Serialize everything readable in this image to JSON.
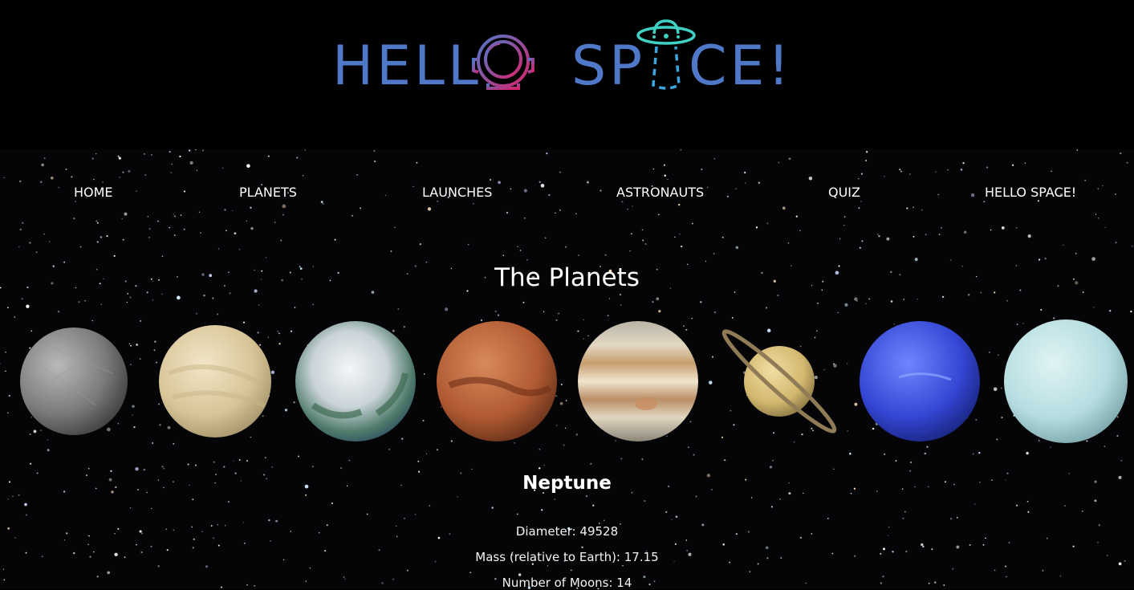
{
  "logo": {
    "text_left": "HELL",
    "text_right": "SP",
    "text_end": "CE!",
    "color": "#4f78c9"
  },
  "nav": {
    "items": [
      {
        "label": "HOME"
      },
      {
        "label": "PLANETS"
      },
      {
        "label": "LAUNCHES"
      },
      {
        "label": "ASTRONAUTS"
      },
      {
        "label": "QUIZ"
      },
      {
        "label": "HELLO SPACE!"
      }
    ]
  },
  "main": {
    "title": "The Planets",
    "planets": [
      {
        "name": "mercury"
      },
      {
        "name": "venus"
      },
      {
        "name": "earth"
      },
      {
        "name": "mars"
      },
      {
        "name": "jupiter"
      },
      {
        "name": "saturn"
      },
      {
        "name": "neptune"
      },
      {
        "name": "uranus"
      }
    ],
    "selected": {
      "name": "Neptune",
      "diameter": "Diameter: 49528",
      "mass": "Mass (relative to Earth): 17.15",
      "moons": "Number of Moons: 14"
    }
  }
}
